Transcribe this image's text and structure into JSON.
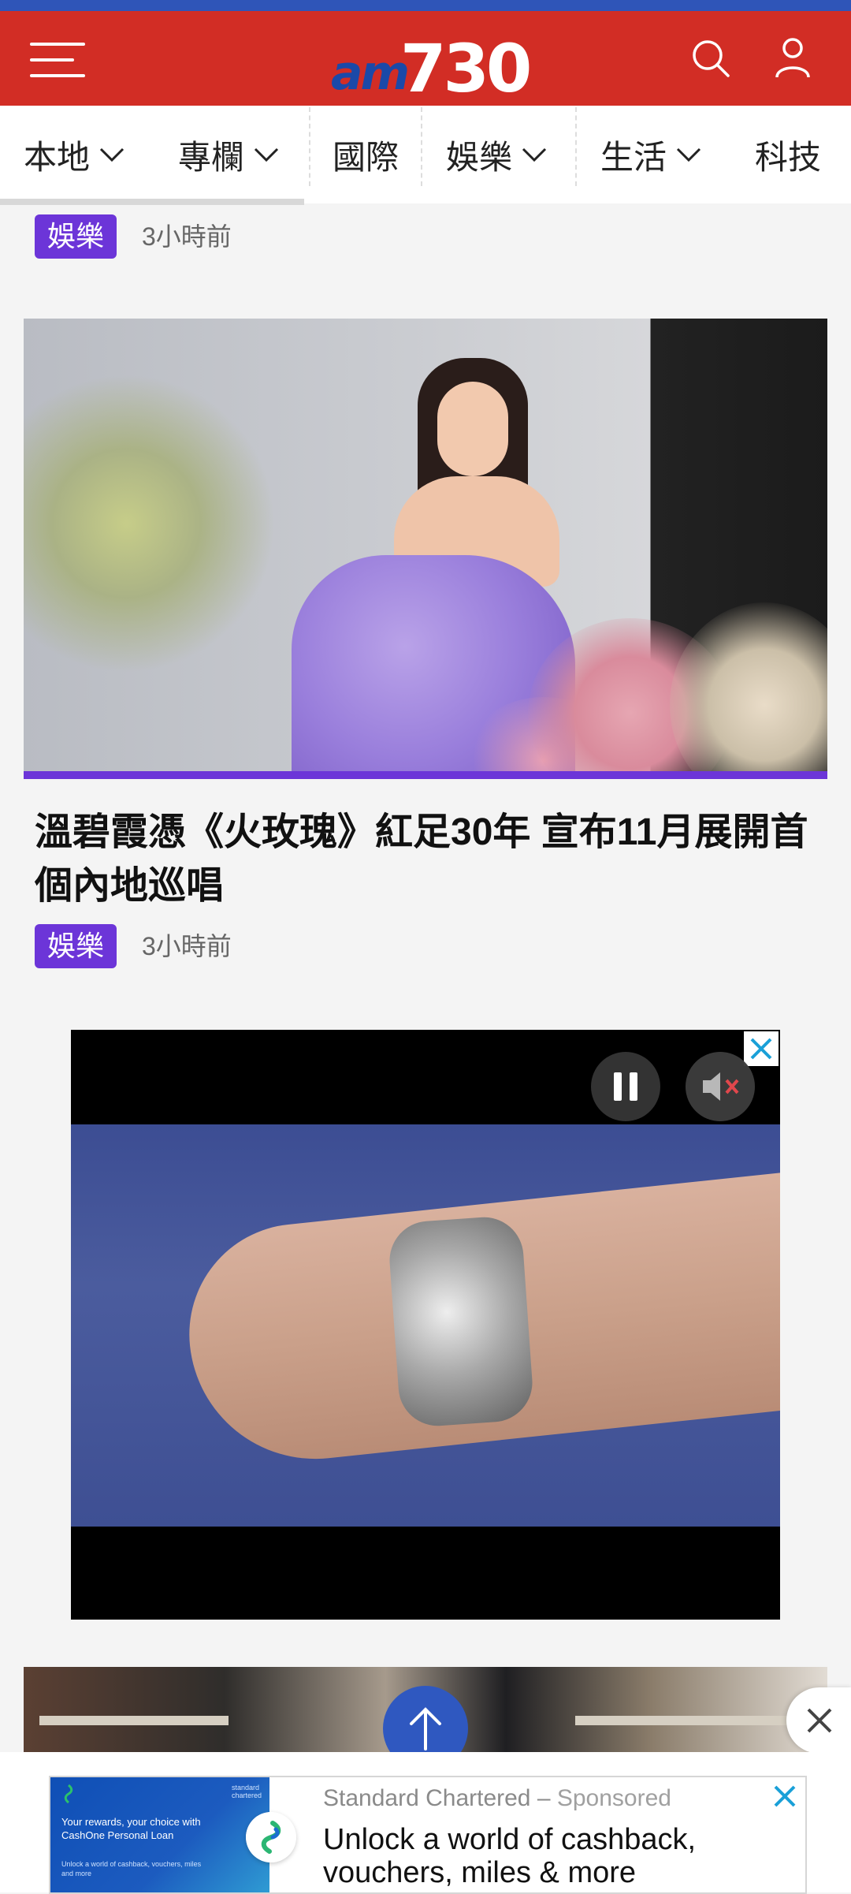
{
  "header": {
    "logo_prefix": "am",
    "logo_number": "730",
    "colors": {
      "brand_red": "#d22d25",
      "brand_blue": "#1b49a8",
      "tag_purple": "#6c35d8"
    }
  },
  "nav": {
    "items": [
      {
        "label": "本地",
        "has_dropdown": true
      },
      {
        "label": "專欄",
        "has_dropdown": true
      },
      {
        "label": "國際",
        "has_dropdown": false
      },
      {
        "label": "娛樂",
        "has_dropdown": true
      },
      {
        "label": "生活",
        "has_dropdown": true
      },
      {
        "label": "科技",
        "has_dropdown": false
      }
    ]
  },
  "articles": [
    {
      "category": "娛樂",
      "time": "3小時前"
    },
    {
      "headline": "溫碧霞憑《火玫瑰》紅足30年 宣布11月展開首個內地巡唱",
      "category": "娛樂",
      "time": "3小時前"
    }
  ],
  "ad_banner": {
    "advertiser": "Standard Chartered",
    "separator": " – ",
    "sponsored_label": "Sponsored",
    "message": "Unlock a world of cashback, vouchers, miles & more",
    "thumb_brand": "standard chartered",
    "thumb_headline": "Your rewards, your choice with CashOne Personal Loan",
    "thumb_sub": "Unlock a world of cashback, vouchers, miles and more"
  }
}
